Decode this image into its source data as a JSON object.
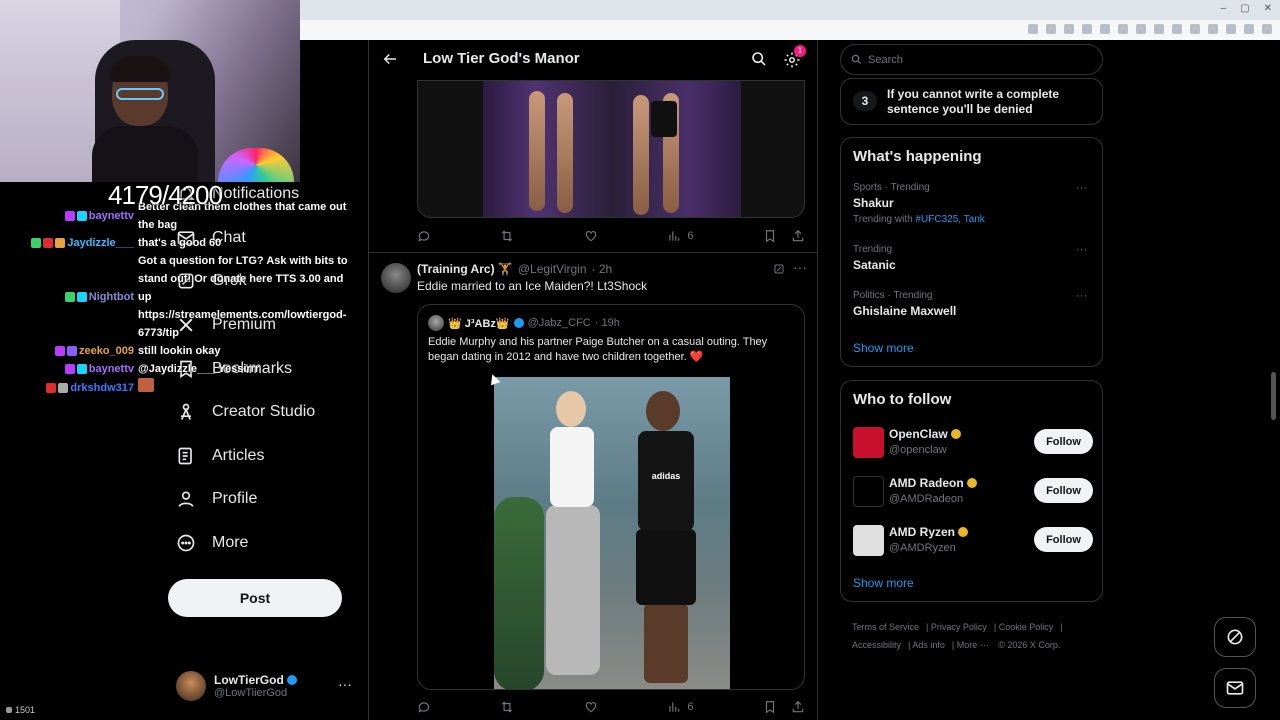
{
  "overlay": {
    "sub_counter": "4179/4200",
    "viewer_count": "1501",
    "chat": [
      {
        "user": "baynettv",
        "color": "#a46cff",
        "msg": "Better clean them clothes that came out the bag"
      },
      {
        "user": "",
        "color": "#fff",
        "msg": "that's a good 60"
      },
      {
        "user": "Jaydizzle___",
        "color": "#3bb8ff",
        "msg": ""
      },
      {
        "user": "Nightbot",
        "color": "#8a8ad8",
        "msg": "Got a question for LTG? Ask with bits to stand out! Or donate here TTS 3.00 and up https://streamelements.com/lowtiergod-6773/tip"
      },
      {
        "user": "zeeko_009",
        "color": "#e8a23a",
        "msg": "still lookin okay"
      },
      {
        "user": "baynettv",
        "color": "#a46cff",
        "msg": "@Jaydizzle___ Yessirrr"
      },
      {
        "user": "drkshdw317",
        "color": "#3b7bff",
        "msg": ""
      }
    ]
  },
  "nav": {
    "notifications": "Notifications",
    "chat": "Chat",
    "grok": "Grok",
    "premium": "Premium",
    "bookmarks": "Bookmarks",
    "creator_studio": "Creator Studio",
    "articles": "Articles",
    "profile": "Profile",
    "more": "More",
    "post": "Post"
  },
  "account": {
    "name": "LowTierGod",
    "handle": "@LowTiierGod",
    "more": "···"
  },
  "header": {
    "title": "Low Tier God's Manor",
    "notif_count": "1"
  },
  "top_post": {
    "views": "6"
  },
  "tweet": {
    "name": "(Training Arc) 🏋",
    "handle": "@LegitVirgin",
    "time": "· 2h",
    "text": "Eddie married to an Ice Maiden?! Lt3Shock",
    "views": "6",
    "quote": {
      "name": "👑 J³ABz👑",
      "handle": "@Jabz_CFC",
      "time": "· 19h",
      "text": "Eddie Murphy and his partner Paige Butcher on a casual outing. They began dating in 2012 and have two children together. ❤️",
      "shirt_logo": "adidas"
    }
  },
  "right": {
    "search_placeholder": "Search",
    "rule": {
      "num": "3",
      "text": "If you cannot write a complete sentence you'll be denied"
    },
    "happening_title": "What's happening",
    "trends": [
      {
        "meta": "Sports · Trending",
        "name": "Shakur",
        "with_label": "Trending with",
        "with_tag": "#UFC325, Tank"
      },
      {
        "meta": "Trending",
        "name": "Satanic",
        "with_label": "",
        "with_tag": ""
      },
      {
        "meta": "Politics · Trending",
        "name": "Ghislaine Maxwell",
        "with_label": "",
        "with_tag": ""
      }
    ],
    "trend_more": "···",
    "show_more": "Show more",
    "who_title": "Who to follow",
    "follow_label": "Follow",
    "who": [
      {
        "name": "OpenClaw",
        "handle": "@openclaw",
        "avatar_color": "#c8102e"
      },
      {
        "name": "AMD Radeon",
        "handle": "@AMDRadeon",
        "avatar_color": "#000000"
      },
      {
        "name": "AMD Ryzen",
        "handle": "@AMDRyzen",
        "avatar_color": "#e0e0e0"
      }
    ],
    "footer": {
      "terms": "Terms of Service",
      "privacy": "Privacy Policy",
      "cookie": "Cookie Policy",
      "accessibility": "Accessibility",
      "ads": "Ads info",
      "more": "More ···",
      "copyright": "© 2026 X Corp."
    }
  },
  "colors": {
    "accent": "#1d9bf0",
    "bg": "#000000",
    "border": "#2f3336",
    "muted": "#71767b",
    "heart": "#f91880"
  }
}
